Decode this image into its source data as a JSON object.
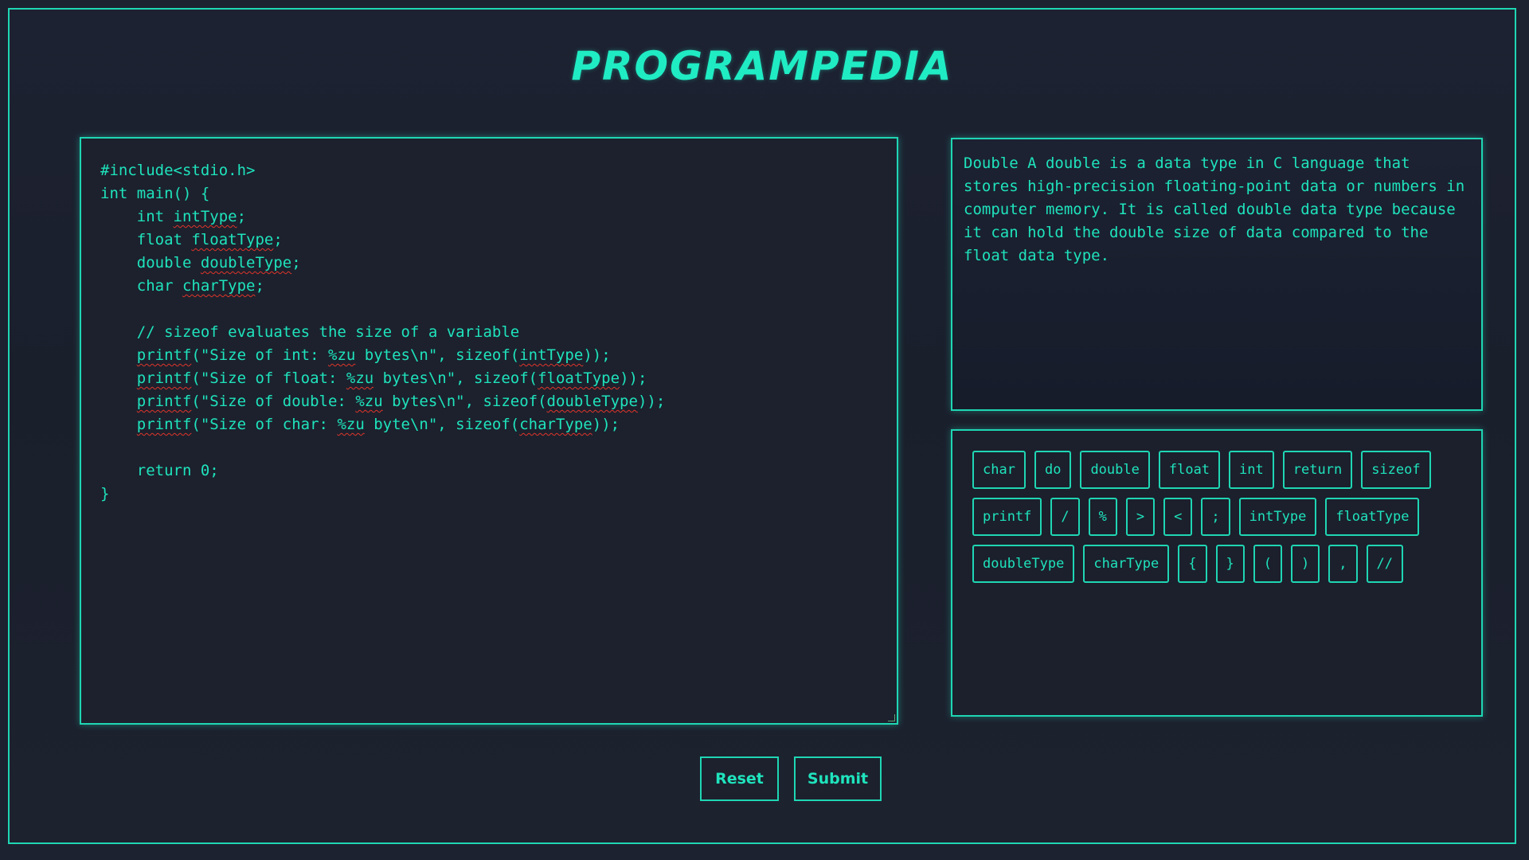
{
  "app": {
    "title": "PROGRAMPEDIA"
  },
  "editor": {
    "lines": [
      {
        "indent": 0,
        "parts": [
          {
            "t": "#include<stdio.h>"
          }
        ]
      },
      {
        "indent": 0,
        "parts": [
          {
            "t": "int main() {"
          }
        ]
      },
      {
        "indent": 1,
        "parts": [
          {
            "t": "int "
          },
          {
            "t": "intType",
            "sq": true
          },
          {
            "t": ";"
          }
        ]
      },
      {
        "indent": 1,
        "parts": [
          {
            "t": "float "
          },
          {
            "t": "floatType",
            "sq": true
          },
          {
            "t": ";"
          }
        ]
      },
      {
        "indent": 1,
        "parts": [
          {
            "t": "double "
          },
          {
            "t": "doubleType",
            "sq": true
          },
          {
            "t": ";"
          }
        ]
      },
      {
        "indent": 1,
        "parts": [
          {
            "t": "char "
          },
          {
            "t": "charType",
            "sq": true
          },
          {
            "t": ";"
          }
        ]
      },
      {
        "indent": 0,
        "parts": []
      },
      {
        "indent": 1,
        "parts": [
          {
            "t": "// sizeof evaluates the size of a variable"
          }
        ]
      },
      {
        "indent": 1,
        "parts": [
          {
            "t": "printf",
            "sq": true
          },
          {
            "t": "(\"Size of int: "
          },
          {
            "t": "%zu",
            "sq": true
          },
          {
            "t": " bytes\\n\", sizeof("
          },
          {
            "t": "intType",
            "sq": true
          },
          {
            "t": "));"
          }
        ]
      },
      {
        "indent": 1,
        "parts": [
          {
            "t": "printf",
            "sq": true
          },
          {
            "t": "(\"Size of float: "
          },
          {
            "t": "%zu",
            "sq": true
          },
          {
            "t": " bytes\\n\", sizeof("
          },
          {
            "t": "floatType",
            "sq": true
          },
          {
            "t": "));"
          }
        ]
      },
      {
        "indent": 1,
        "parts": [
          {
            "t": "printf",
            "sq": true
          },
          {
            "t": "(\"Size of double: "
          },
          {
            "t": "%zu",
            "sq": true
          },
          {
            "t": " bytes\\n\", sizeof("
          },
          {
            "t": "doubleType",
            "sq": true
          },
          {
            "t": "));"
          }
        ]
      },
      {
        "indent": 1,
        "parts": [
          {
            "t": "printf",
            "sq": true
          },
          {
            "t": "(\"Size of char: "
          },
          {
            "t": "%zu",
            "sq": true
          },
          {
            "t": " byte\\n\", sizeof("
          },
          {
            "t": "charType",
            "sq": true
          },
          {
            "t": "));"
          }
        ]
      },
      {
        "indent": 0,
        "parts": []
      },
      {
        "indent": 1,
        "parts": [
          {
            "t": "return 0;"
          }
        ]
      },
      {
        "indent": 0,
        "parts": [
          {
            "t": "}"
          }
        ]
      }
    ]
  },
  "description": {
    "text": "Double A double is a data type in C language that stores high-precision floating-point data or numbers in computer memory. It is called double data type because it can hold the double size of data compared to the float data type."
  },
  "keywords": {
    "rows": [
      [
        "char",
        "do",
        "double",
        "float",
        "int",
        "return",
        "sizeof"
      ],
      [
        "printf",
        "/",
        "%",
        ">",
        "<",
        ";",
        "intType",
        "floatType"
      ],
      [
        "doubleType",
        "charType",
        "{",
        "}",
        "(",
        ")",
        ",",
        "//"
      ]
    ]
  },
  "actions": {
    "reset_label": "Reset",
    "submit_label": "Submit"
  },
  "colors": {
    "accent": "#1fd6b4",
    "text": "#1fe3bd",
    "background": "#1d2230",
    "error_squiggle": "#e0342a"
  }
}
